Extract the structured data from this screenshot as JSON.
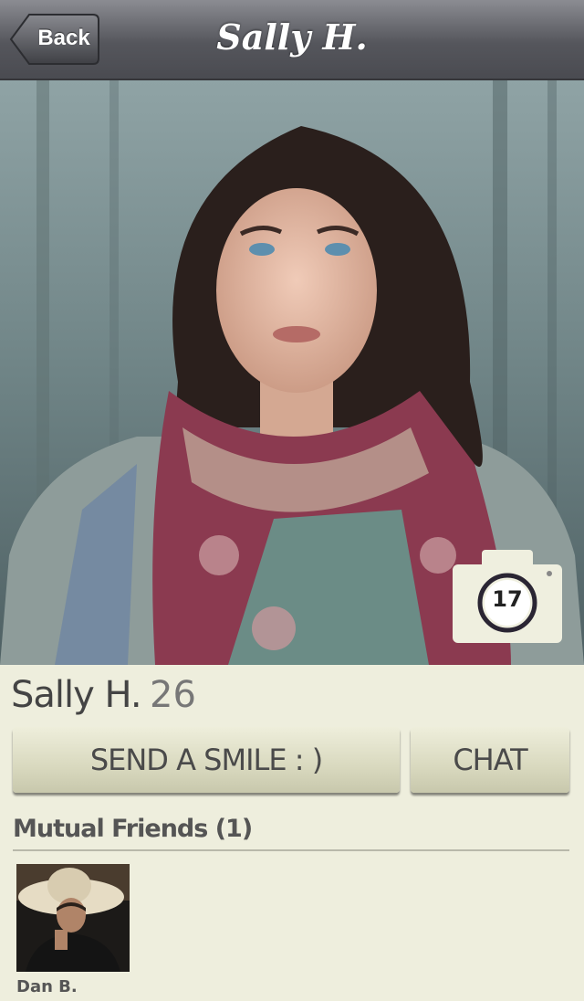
{
  "navbar": {
    "back_label": "Back",
    "title": "Sally H."
  },
  "profile": {
    "photo_count": "17",
    "name": "Sally H.",
    "age": "26"
  },
  "actions": {
    "send_smile_label": "SEND A SMILE   : )",
    "chat_label": "CHAT"
  },
  "mutual_friends": {
    "title": "Mutual Friends (1)",
    "items": [
      {
        "name": "Dan B."
      }
    ]
  },
  "icons": {
    "camera": "camera-icon"
  }
}
